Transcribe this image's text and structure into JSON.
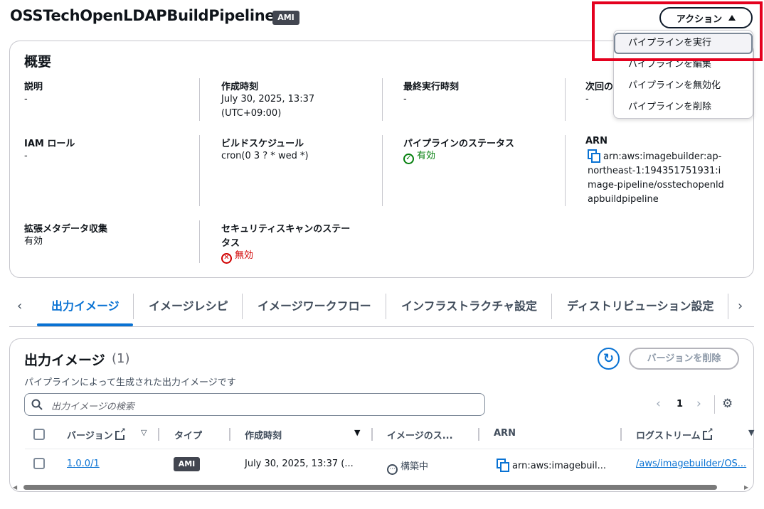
{
  "header": {
    "title": "OSSTechOpenLDAPBuildPipeline",
    "badge": "AMI",
    "actions_label": "アクション"
  },
  "actions_menu": {
    "items": [
      "パイプラインを実行",
      "パイプラインを編集",
      "パイプラインを無効化",
      "パイプラインを削除"
    ]
  },
  "overview": {
    "title": "概要",
    "description_label": "説明",
    "description_value": "-",
    "created_label": "作成時刻",
    "created_value_1": "July 30, 2025, 13:37",
    "created_value_2": "(UTC+09:00)",
    "last_run_label": "最終実行時刻",
    "last_run_value": "-",
    "next_run_label": "次回の",
    "next_run_value": "-",
    "iam_label": "IAM ロール",
    "iam_value": "-",
    "schedule_label": "ビルドスケジュール",
    "schedule_value": "cron(0 3 ? * wed *)",
    "pipeline_status_label": "パイプラインのステータス",
    "pipeline_status_value": "有効",
    "arn_label": "ARN",
    "arn_lines": [
      "arn:aws:imagebuilder:ap-",
      "northeast-1:194351751931:i",
      "mage-pipeline/osstechopenld",
      "apbuildpipeline"
    ],
    "metadata_label": "拡張メタデータ収集",
    "metadata_value": "有効",
    "security_label_1": "セキュリティスキャンのステー",
    "security_label_2": "タス",
    "security_value": "無効"
  },
  "tabs": [
    "出力イメージ",
    "イメージレシピ",
    "イメージワークフロー",
    "インフラストラクチャ設定",
    "ディストリビューション設定"
  ],
  "output_images": {
    "title": "出力イメージ",
    "count": "(1)",
    "description": "パイプラインによって生成された出力イメージです",
    "delete_version_label": "バージョンを削除",
    "search_placeholder": "出力イメージの検索",
    "page_number": "1",
    "columns": [
      "バージョン",
      "タイプ",
      "作成時刻",
      "イメージのス...",
      "ARN",
      "ログストリーム"
    ],
    "rows": [
      {
        "version": "1.0.0/1",
        "type": "AMI",
        "created": "July 30, 2025, 13:37 (...",
        "status": "構築中",
        "arn": "arn:aws:imagebuil...",
        "log_stream": "/aws/imagebuilder/OS..."
      }
    ]
  },
  "colors": {
    "accent": "#0972d3",
    "success": "#037f0c",
    "error": "#d10000",
    "highlight": "#e4001e"
  }
}
